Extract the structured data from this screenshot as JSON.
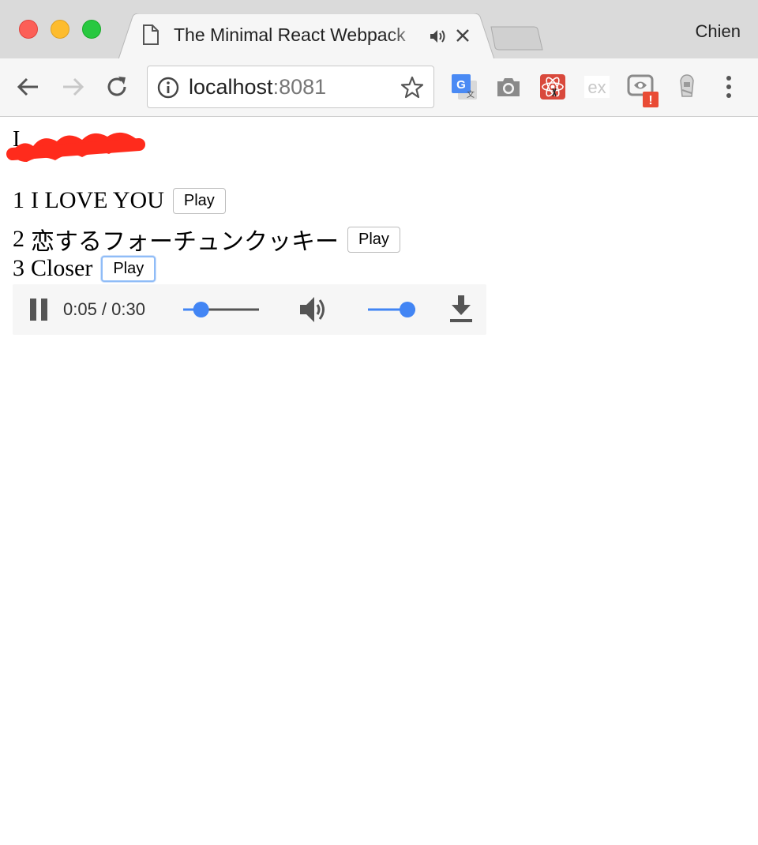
{
  "window": {
    "profile_name": "Chien"
  },
  "tab": {
    "title": "The Minimal React Webpack",
    "icon": "document-icon",
    "audio_icon": "speaker-icon",
    "close_icon": "close-icon"
  },
  "toolbar": {
    "url_host": "localhost",
    "url_port": ":8081",
    "extensions": [
      "google-translate-icon",
      "camera-icon",
      "react-devtools-icon",
      "ex-extension-icon",
      "extension-alert-icon",
      "lighthouse-icon"
    ]
  },
  "page": {
    "header_text": "I",
    "tracks": [
      {
        "number": "1",
        "title": "I LOVE YOU",
        "button": "Play",
        "focused": false
      },
      {
        "number": "2",
        "title": "恋するフォーチュンクッキー",
        "button": "Play",
        "focused": false
      },
      {
        "number": "3",
        "title": "Closer",
        "button": "Play",
        "focused": true
      }
    ],
    "player": {
      "time": "0:05 / 0:30",
      "progress_fraction": 0.167,
      "volume_fraction": 1.0,
      "state": "playing"
    }
  },
  "colors": {
    "accent": "#4285f4",
    "redaction": "#ff2b1c",
    "traffic_close": "#fc5f57",
    "traffic_min": "#fdbc2e",
    "traffic_max": "#28c840"
  }
}
